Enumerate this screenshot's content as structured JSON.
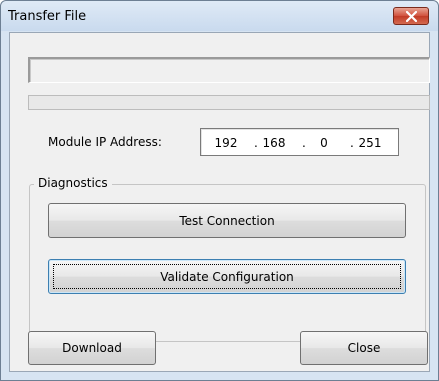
{
  "window": {
    "title": "Transfer File"
  },
  "status": {
    "text": ""
  },
  "progress": {
    "value": 0
  },
  "ip": {
    "label": "Module IP Address:",
    "octets": [
      "192",
      "168",
      "0",
      "251"
    ],
    "separator": "."
  },
  "diagnostics": {
    "title": "Diagnostics",
    "test_label": "Test Connection",
    "validate_label": "Validate Configuration"
  },
  "footer": {
    "download_label": "Download",
    "close_label": "Close"
  },
  "colors": {
    "close_button": "#c23b26",
    "titlebar": "#c9daee"
  },
  "icons": {
    "close": "close-icon"
  }
}
